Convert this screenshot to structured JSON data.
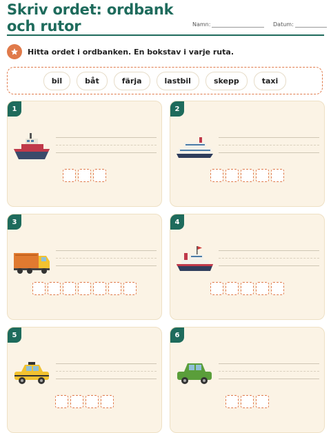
{
  "header": {
    "title": "Skriv ordet: ordbank och rutor",
    "name_label": "Namn:",
    "date_label": "Datum:"
  },
  "instruction": {
    "icon": "star-icon",
    "text": "Hitta ordet i ordbanken. En bokstav i varje ruta."
  },
  "word_bank": [
    "bil",
    "båt",
    "färja",
    "lastbil",
    "skepp",
    "taxi"
  ],
  "cards": [
    {
      "number": "1",
      "picture": "boat-icon",
      "box_count": 3
    },
    {
      "number": "2",
      "picture": "ferry-icon",
      "box_count": 5
    },
    {
      "number": "3",
      "picture": "truck-icon",
      "box_count": 7
    },
    {
      "number": "4",
      "picture": "ship-icon",
      "box_count": 5
    },
    {
      "number": "5",
      "picture": "taxi-icon",
      "box_count": 4
    },
    {
      "number": "6",
      "picture": "car-icon",
      "box_count": 3
    }
  ],
  "colors": {
    "accent": "#1e6b5c",
    "orange": "#e07a4a",
    "card_bg": "#fbf3e5"
  }
}
